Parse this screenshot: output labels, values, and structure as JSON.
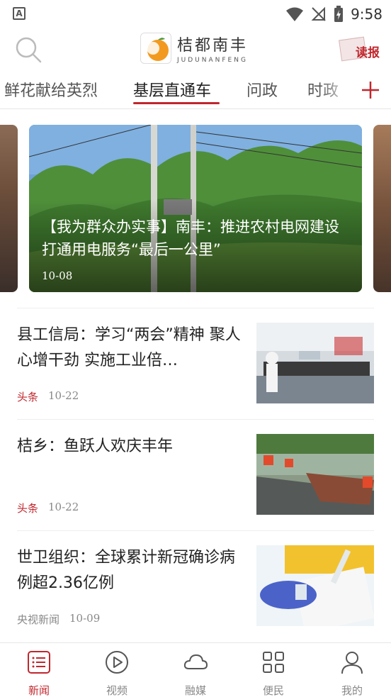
{
  "status_bar": {
    "time": "9:58",
    "app_badge": "A"
  },
  "header": {
    "logo_cn": "桔都南丰",
    "logo_en": "JUDUNANFENG",
    "logo_badge_text": "桔都南丰",
    "read_label": "读报"
  },
  "tabs": [
    {
      "label": "鲜花献给英烈"
    },
    {
      "label": "基层直通车"
    },
    {
      "label": "问政"
    },
    {
      "label": "时政"
    }
  ],
  "carousel": {
    "title": "【我为群众办实事】南丰：推进农村电网建设 打通用电服务“最后一公里”",
    "date": "10-08"
  },
  "news": [
    {
      "title": "县工信局：学习“两会”精神 聚人心增干劲 实施工业倍…",
      "source": "头条",
      "date": "10-22"
    },
    {
      "title": "桔乡：鱼跃人欢庆丰年",
      "source": "头条",
      "date": "10-22"
    },
    {
      "title": "世卫组织：全球累计新冠确诊病例超2.36亿例",
      "source": "央视新闻",
      "date": "10-09"
    }
  ],
  "bottom_nav": [
    {
      "label": "新闻"
    },
    {
      "label": "视频"
    },
    {
      "label": "融媒"
    },
    {
      "label": "便民"
    },
    {
      "label": "我的"
    }
  ],
  "colors": {
    "accent": "#c0272d",
    "text": "#222222",
    "muted": "#888888"
  }
}
